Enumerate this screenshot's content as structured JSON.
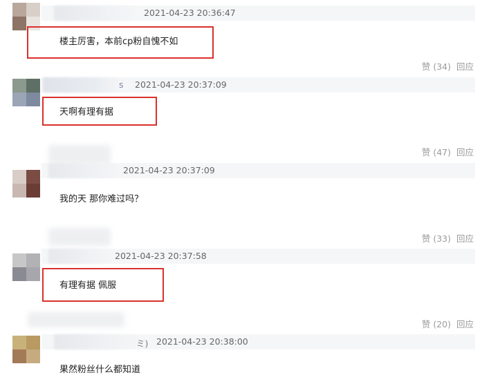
{
  "comments": [
    {
      "timestamp": "2021-04-23 20:36:47",
      "text": "楼主厉害，本前cp粉自愧不如",
      "like_label": "赞 (34)",
      "reply_label": "回应",
      "name_suffix": ""
    },
    {
      "timestamp": "2021-04-23 20:37:09",
      "text": "天啊有理有据",
      "like_label": "赞 (47)",
      "reply_label": "回应",
      "name_suffix": "s"
    },
    {
      "timestamp": "2021-04-23 20:37:09",
      "text": "我的天 那你难过吗？",
      "like_label": "赞 (33)",
      "reply_label": "回应",
      "name_suffix": ""
    },
    {
      "timestamp": "2021-04-23 20:37:58",
      "text": "有理有据 佩服",
      "like_label": "赞 (20)",
      "reply_label": "回应",
      "name_suffix": ""
    },
    {
      "timestamp": "2021-04-23 20:38:00",
      "text": "果然粉丝什么都知道",
      "like_label": "",
      "reply_label": "",
      "name_suffix": "ミ)"
    }
  ],
  "colors": {
    "highlight_box": "#d9302c",
    "timestamp": "#666666",
    "action": "#9a9a9a",
    "header_band": "#f5f6f7"
  }
}
